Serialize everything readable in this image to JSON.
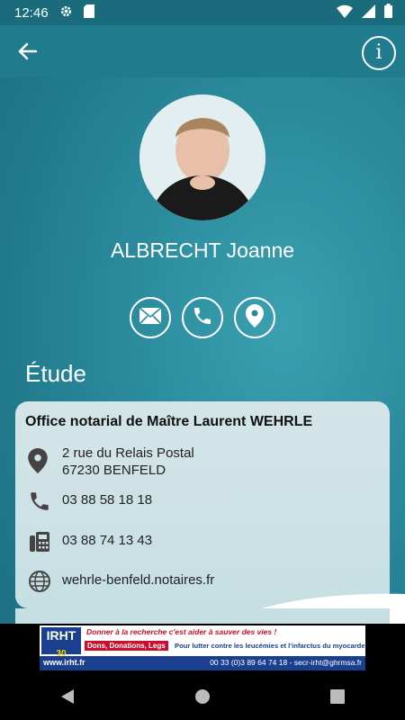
{
  "status": {
    "time": "12:46"
  },
  "header": {
    "info_label": "i"
  },
  "profile": {
    "name": "ALBRECHT Joanne"
  },
  "actions": [
    {
      "icon": "mail-icon"
    },
    {
      "icon": "phone-icon"
    },
    {
      "icon": "location-pin-icon"
    }
  ],
  "section": {
    "title": "Étude"
  },
  "office": {
    "name": "Office notarial de Maître Laurent WEHRLE",
    "address_line1": "2 rue du Relais Postal",
    "address_line2": "67230 BENFELD",
    "phone": "03 88 58 18 18",
    "fax": "03 88 74 13 43",
    "website": "wehrle-benfeld.notaires.fr"
  },
  "ad": {
    "logo": "IRHT",
    "logo_years": "30",
    "tagline": "Donner à la recherche c'est aider à sauver des vies !",
    "badge": "Dons, Donations, Legs",
    "cause": "Pour lutter contre les leucémies et l'infarctus du myocarde",
    "url": "www.irht.fr",
    "contact": "00 33 (0)3 89 64 74 18 - secr-irht@ghrmsa.fr"
  },
  "colors": {
    "accent": "#1f7b8d",
    "card": "#cfe3e6",
    "ad_red": "#c8102e",
    "ad_blue": "#1b3f8f"
  }
}
